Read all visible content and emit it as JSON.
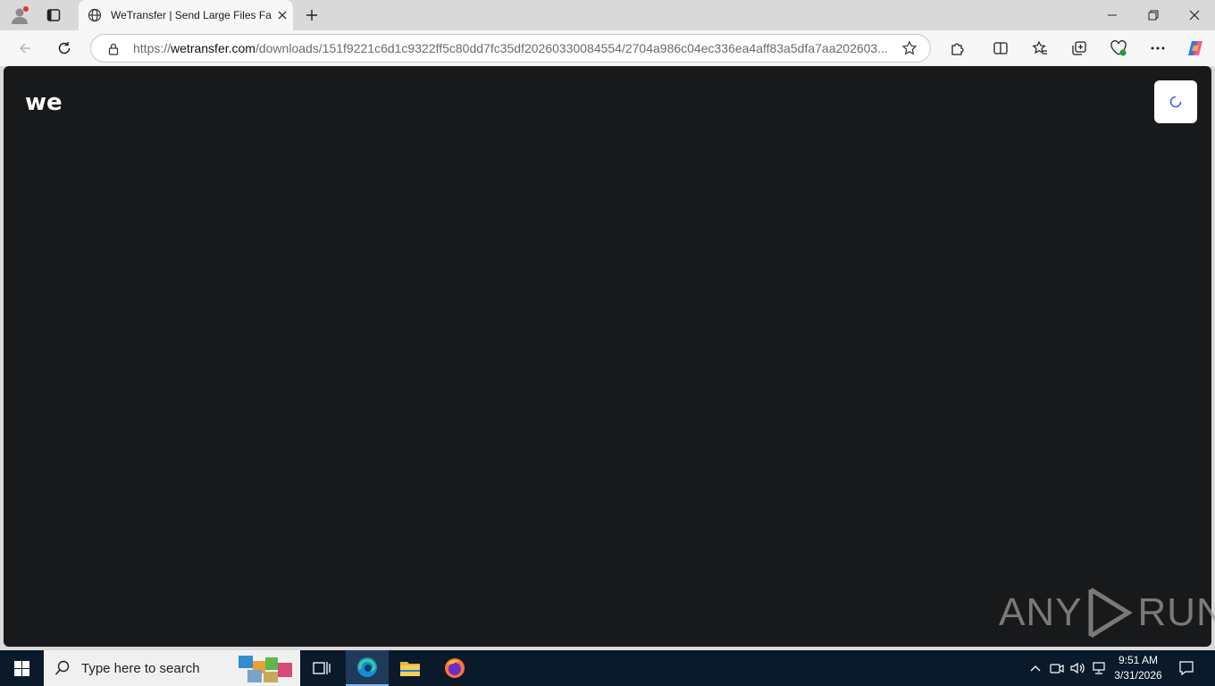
{
  "browser": {
    "tab_title": "WeTransfer | Send Large Files Fast",
    "url_prefix": "https://",
    "url_host": "wetransfer.com",
    "url_path": "/downloads/151f9221c6d1c9322ff5c80dd7fc35df20260330084554/2704a986c04ec336ea4aff83a5dfa7aa202603..."
  },
  "page": {
    "background_color": "#17191b",
    "logo_text": "we"
  },
  "watermark": {
    "left": "ANY",
    "right": "RUN"
  },
  "taskbar": {
    "search_placeholder": "Type here to search",
    "time": "9:51 AM",
    "date": "3/31/2026"
  }
}
